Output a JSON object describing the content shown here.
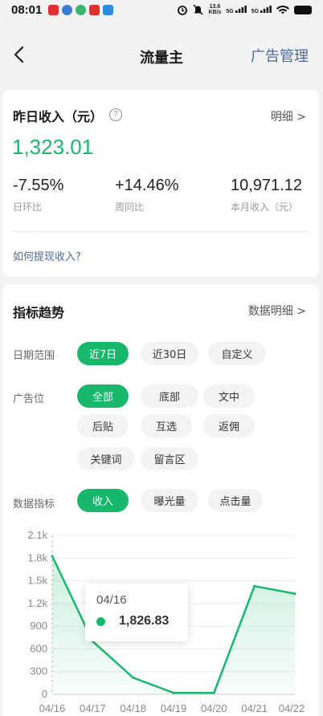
{
  "status": {
    "time": "08:01",
    "speed_value": "13.6",
    "speed_unit": "KB/s",
    "net1": "5G",
    "net2": "5G"
  },
  "nav": {
    "back_icon": "chevron-left-icon",
    "title": "流量主",
    "action": "广告管理"
  },
  "income": {
    "title": "昨日收入（元）",
    "help_icon": "question-mark-icon",
    "help_glyph": "?",
    "detail": "明细 >",
    "amount": "1,323.01",
    "stats": [
      {
        "value": "-7.55%",
        "label": "日环比"
      },
      {
        "value": "+14.46%",
        "label": "周同比"
      },
      {
        "value": "10,971.12",
        "label": "本月收入（元）"
      }
    ],
    "withdraw": "如何提现收入?"
  },
  "trend": {
    "title": "指标趋势",
    "detail": "数据明细 >",
    "date_range": {
      "label": "日期范围",
      "options": [
        "近7日",
        "近30日",
        "自定义"
      ],
      "selected": "近7日"
    },
    "ad_slot": {
      "label": "广告位",
      "options": [
        "全部",
        "底部",
        "文中",
        "后贴",
        "互选",
        "返佣",
        "关键词",
        "留言区"
      ],
      "selected": "全部"
    },
    "metric": {
      "label": "数据指标",
      "options": [
        "收入",
        "曝光量",
        "点击量"
      ],
      "selected": "收入"
    }
  },
  "tooltip": {
    "date": "04/16",
    "value": "1,826.83"
  },
  "colors": {
    "accent": "#17b86c",
    "link": "#4b6a9b"
  },
  "chart_data": {
    "type": "area",
    "x": [
      "04/16",
      "04/17",
      "04/18",
      "04/19",
      "04/20",
      "04/21",
      "04/22"
    ],
    "series": [
      {
        "values": [
          1826.83,
          700,
          220,
          20,
          20,
          1430,
          1330
        ]
      }
    ],
    "y_ticks": [
      "0",
      "300",
      "600",
      "900",
      "1.2k",
      "1.5k",
      "1.8k",
      "2.1k"
    ],
    "ylim": [
      0,
      2100
    ],
    "grid": true
  }
}
